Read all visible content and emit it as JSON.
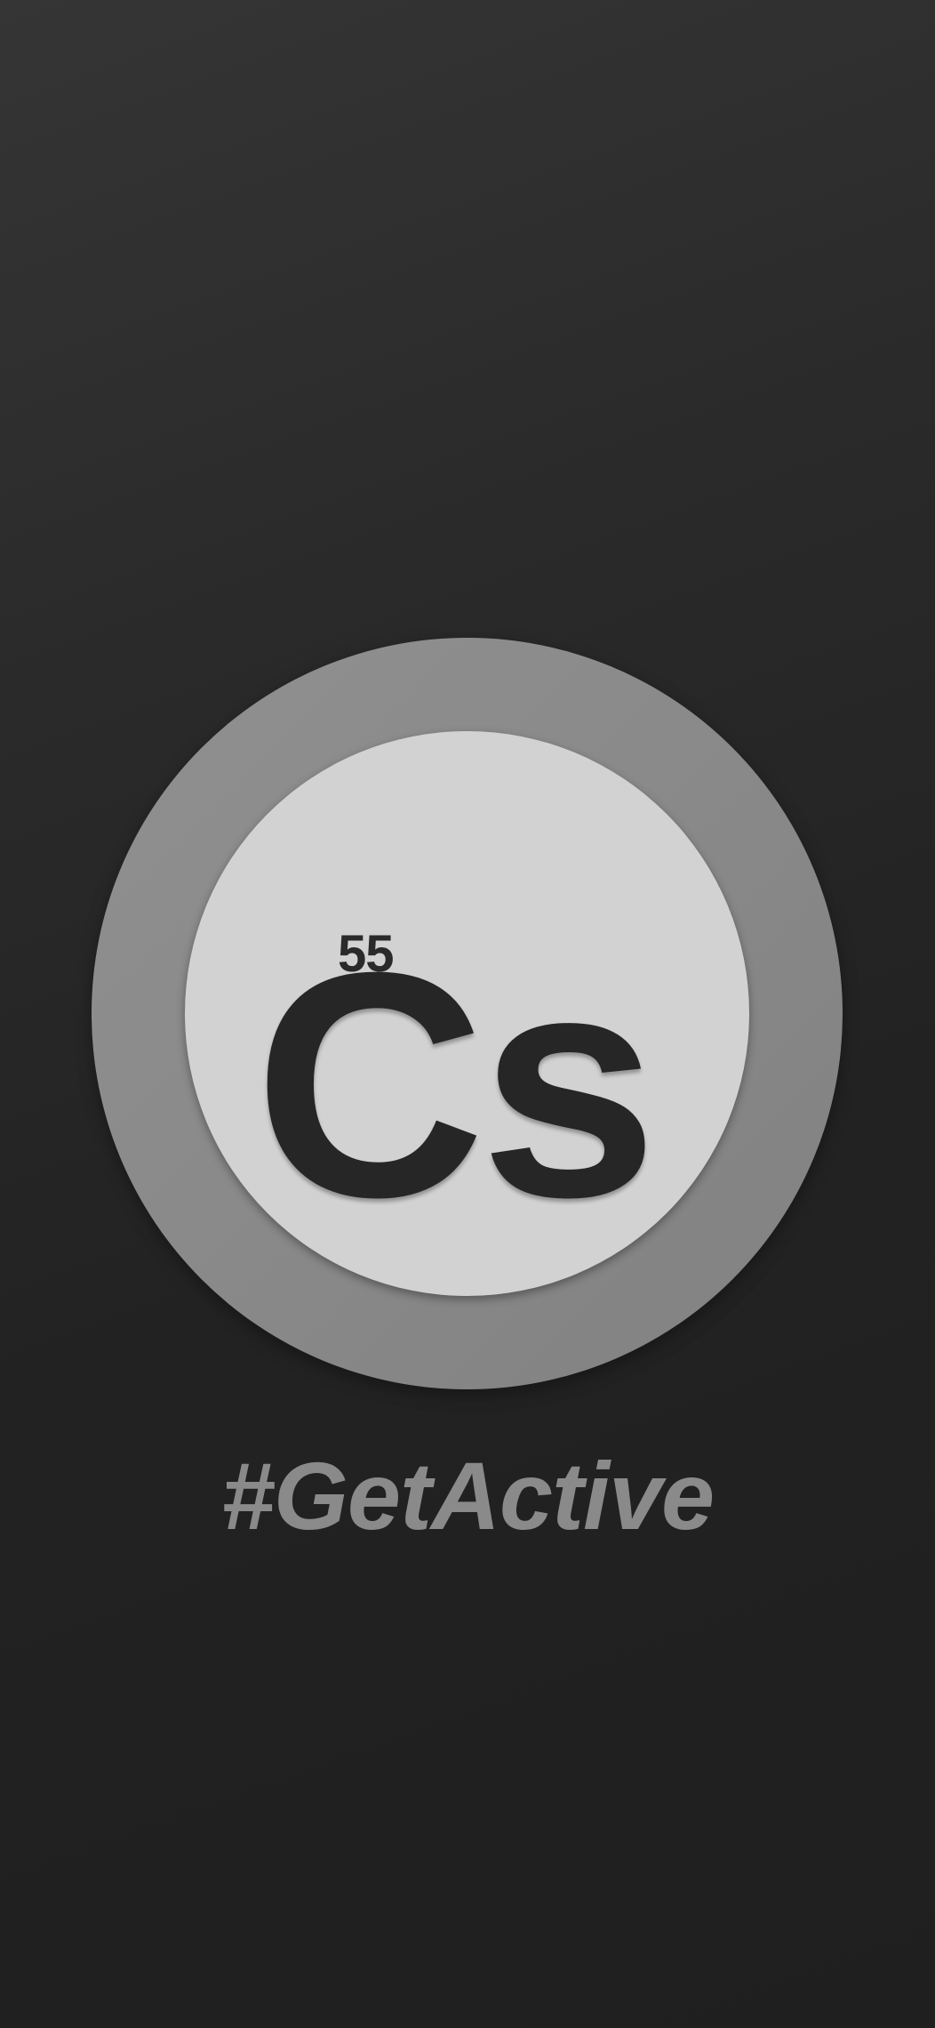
{
  "element": {
    "atomic_number": "55",
    "symbol": "Cs"
  },
  "tagline": "#GetActive",
  "colors": {
    "background": "#222222",
    "outer_ring": "#8a8a8a",
    "inner_disc": "#d2d2d2",
    "symbol_text": "#262626",
    "tagline_text": "#8a8a8a"
  }
}
